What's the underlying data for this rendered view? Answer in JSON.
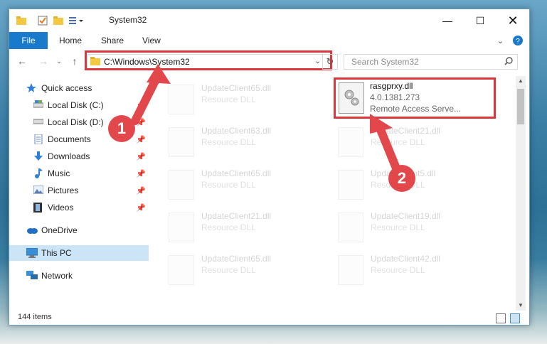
{
  "window": {
    "title": "System32"
  },
  "ribbon": {
    "tabs": [
      "File",
      "Home",
      "Share",
      "View"
    ]
  },
  "address": {
    "path": "C:\\Windows\\System32"
  },
  "search": {
    "placeholder": "Search System32"
  },
  "sidebar": {
    "items": [
      {
        "label": "Quick access",
        "icon": "star-icon"
      },
      {
        "label": "Local Disk (C:)",
        "icon": "drive-icon"
      },
      {
        "label": "Local Disk (D:)",
        "icon": "drive-icon"
      },
      {
        "label": "Documents",
        "icon": "documents-icon"
      },
      {
        "label": "Downloads",
        "icon": "download-icon"
      },
      {
        "label": "Music",
        "icon": "music-icon"
      },
      {
        "label": "Pictures",
        "icon": "pictures-icon"
      },
      {
        "label": "Videos",
        "icon": "videos-icon"
      },
      {
        "label": "OneDrive",
        "icon": "cloud-icon"
      },
      {
        "label": "This PC",
        "icon": "pc-icon"
      },
      {
        "label": "Network",
        "icon": "network-icon"
      }
    ]
  },
  "files": [
    {
      "name": "UpdateClient65.dll",
      "desc": "Resource DLL"
    },
    {
      "name": "UpdateClient63.dll",
      "desc": "Resource DLL"
    },
    {
      "name": "UpdateClient21.dll",
      "desc": "Resource DLL"
    },
    {
      "name": "UpdateClient65.dll",
      "desc": "Resource DLL"
    },
    {
      "name": "UpdateClient5.dll",
      "desc": "Resource DLL"
    },
    {
      "name": "UpdateClient21.dll",
      "desc": "Resource DLL"
    },
    {
      "name": "UpdateClient19.dll",
      "desc": "Resource DLL"
    },
    {
      "name": "UpdateClient65.dll",
      "desc": "Resource DLL"
    },
    {
      "name": "UpdateClient42.dll",
      "desc": "Resource DLL"
    }
  ],
  "highlight_file": {
    "name": "rasgprxy.dll",
    "version": "4.0.1381.273",
    "desc": "Remote Access Serve..."
  },
  "status": {
    "items_count": "144 items"
  },
  "callouts": [
    "1",
    "2"
  ],
  "colors": {
    "accent": "#1979ca",
    "highlight": "#d9363e"
  }
}
